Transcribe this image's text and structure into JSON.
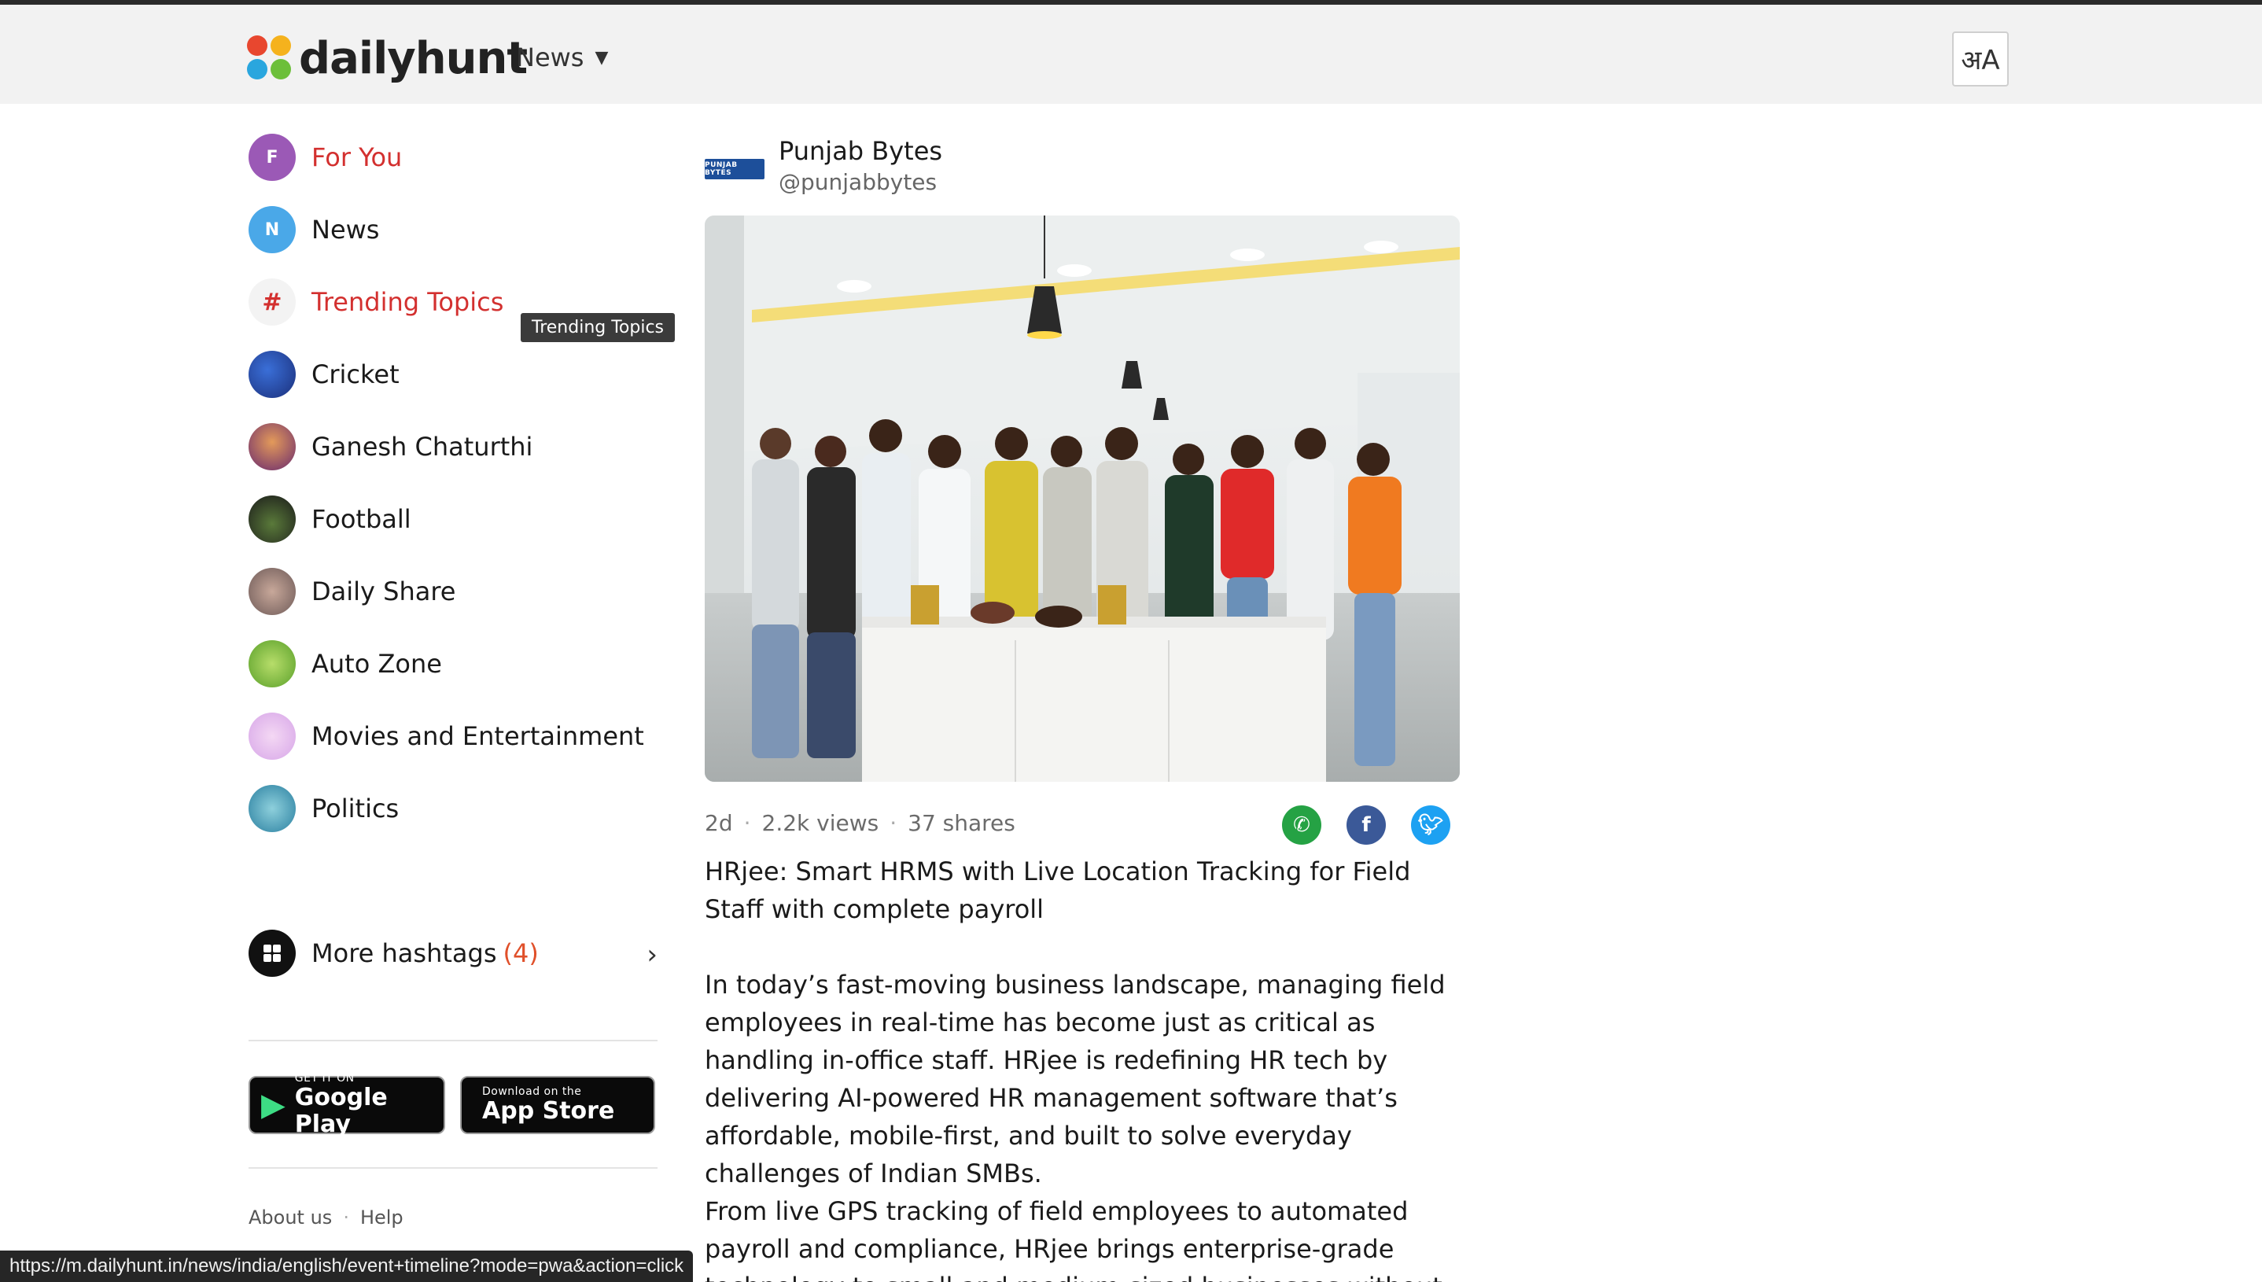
{
  "header": {
    "logo_text": "dailyhunt",
    "nav_label": "News",
    "language_glyph": "अA"
  },
  "sidebar": {
    "items": [
      {
        "label": "For You",
        "initial": "F",
        "active": true
      },
      {
        "label": "News",
        "initial": "N",
        "active": false
      },
      {
        "label": "Trending Topics",
        "initial": "#",
        "active": true
      },
      {
        "label": "Cricket",
        "initial": "",
        "active": false
      },
      {
        "label": "Ganesh Chaturthi",
        "initial": "",
        "active": false
      },
      {
        "label": "Football",
        "initial": "",
        "active": false
      },
      {
        "label": "Daily Share",
        "initial": "",
        "active": false
      },
      {
        "label": "Auto Zone",
        "initial": "",
        "active": false
      },
      {
        "label": "Movies and Entertainment",
        "initial": "",
        "active": false
      },
      {
        "label": "Politics",
        "initial": "",
        "active": false
      }
    ],
    "tooltip": "Trending Topics",
    "more_label": "More hashtags",
    "more_count": "(4)"
  },
  "stores": {
    "google_small": "GET IT ON",
    "google_big": "Google Play",
    "apple_small": "Download on the",
    "apple_big": "App Store"
  },
  "footer": {
    "about": "About us",
    "help": "Help"
  },
  "status_url": "https://m.dailyhunt.in/news/india/english/event+timeline?mode=pwa&action=click",
  "article": {
    "publisher_name": "Punjab Bytes",
    "publisher_handle": "@punjabbytes",
    "publisher_logo_text": "PUNJAB BYTES",
    "age": "2d",
    "views": "2.2k views",
    "shares": "37 shares",
    "headline": "HRjee: Smart HRMS with Live Location Tracking for Field Staff with complete payroll",
    "para1": "In today’s fast-moving business landscape, managing field employees in real-time has become just as critical as handling in-office staff. HRjee is redefining HR tech by delivering AI-powered HR management software that’s affordable, mobile-first, and built to solve everyday challenges of Indian SMBs.",
    "para2": "From live GPS tracking of field employees to automated payroll and compliance, HRjee brings enterprise-grade technology to small and medium-sized businesses without the burden of"
  },
  "colors": {
    "accent_red": "#d3302f",
    "whatsapp": "#25a244",
    "facebook": "#3b5998",
    "twitter": "#1da1f2"
  }
}
